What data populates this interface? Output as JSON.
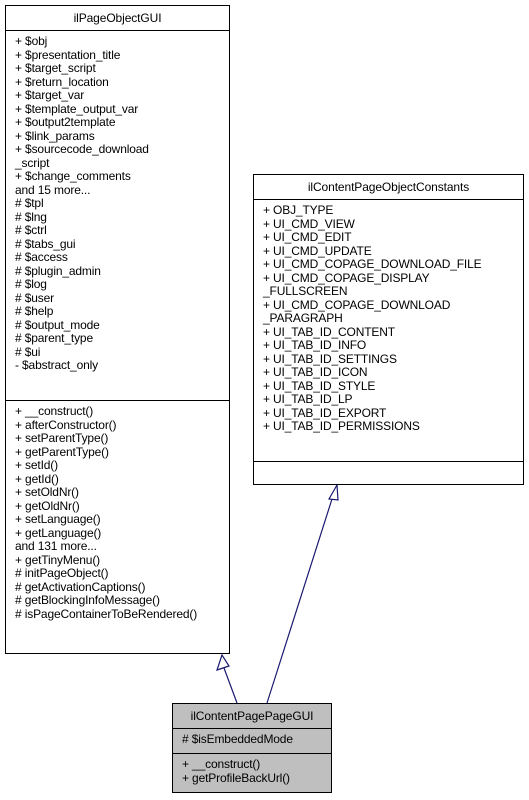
{
  "diagram": {
    "type": "uml-class-inheritance",
    "edge_color": "#191970",
    "highlight_fill": "#bfbfbf",
    "classes": {
      "parent_gui": {
        "name": "ilPageObjectGUI",
        "attributes": [
          "+ $obj",
          "+ $presentation_title",
          "+ $target_script",
          "+ $return_location",
          "+ $target_var",
          "+ $template_output_var",
          "+ $output2template",
          "+ $link_params",
          "+ $sourcecode_download",
          "_script",
          "+ $change_comments",
          "and 15 more...",
          "# $tpl",
          "# $lng",
          "# $ctrl",
          "# $tabs_gui",
          "# $access",
          "# $plugin_admin",
          "# $log",
          "# $user",
          "# $help",
          "# $output_mode",
          "# $parent_type",
          "# $ui",
          "- $abstract_only"
        ],
        "operations": [
          "+ __construct()",
          "+ afterConstructor()",
          "+ setParentType()",
          "+ getParentType()",
          "+ setId()",
          "+ getId()",
          "+ setOldNr()",
          "+ getOldNr()",
          "+ setLanguage()",
          "+ getLanguage()",
          "and 131 more...",
          "+ getTinyMenu()",
          "# initPageObject()",
          "# getActivationCaptions()",
          "# getBlockingInfoMessage()",
          "# isPageContainerToBeRendered()"
        ]
      },
      "constants": {
        "name": "ilContentPageObjectConstants",
        "attributes": [
          "+ OBJ_TYPE",
          "+ UI_CMD_VIEW",
          "+ UI_CMD_EDIT",
          "+ UI_CMD_UPDATE",
          "+ UI_CMD_COPAGE_DOWNLOAD_FILE",
          "+ UI_CMD_COPAGE_DISPLAY",
          "_FULLSCREEN",
          "+ UI_CMD_COPAGE_DOWNLOAD",
          "_PARAGRAPH",
          "+ UI_TAB_ID_CONTENT",
          "+ UI_TAB_ID_INFO",
          "+ UI_TAB_ID_SETTINGS",
          "+ UI_TAB_ID_ICON",
          "+ UI_TAB_ID_STYLE",
          "+ UI_TAB_ID_LP",
          "+ UI_TAB_ID_EXPORT",
          "+ UI_TAB_ID_PERMISSIONS"
        ],
        "operations": []
      },
      "child": {
        "name": "ilContentPagePageGUI",
        "attributes": [
          "# $isEmbeddedMode"
        ],
        "operations": [
          "+ __construct()",
          "+ getProfileBackUrl()"
        ]
      }
    },
    "relations": [
      {
        "from": "ilContentPagePageGUI",
        "to": "ilPageObjectGUI",
        "kind": "generalization"
      },
      {
        "from": "ilContentPagePageGUI",
        "to": "ilContentPageObjectConstants",
        "kind": "generalization"
      }
    ]
  }
}
